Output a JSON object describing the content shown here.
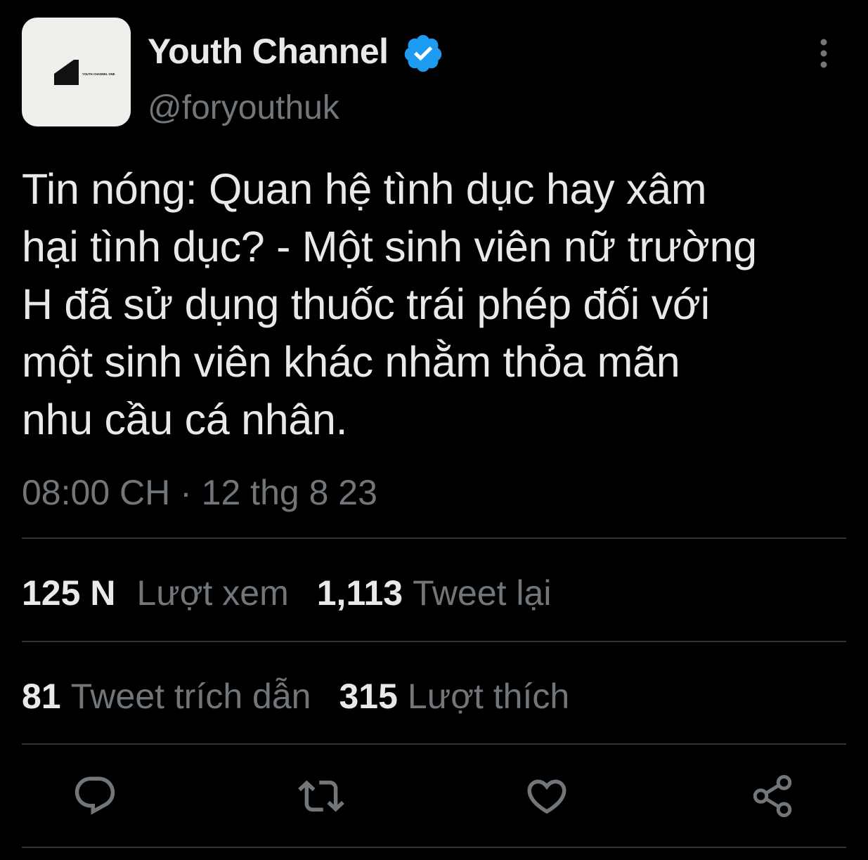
{
  "tweet": {
    "author": {
      "display_name": "Youth Channel",
      "handle": "@foryouthuk",
      "verified": true,
      "avatar_text": "YOUTH CHANNEL ONE"
    },
    "text": "Tin nóng: Quan hệ tình dục hay xâm\nhại tình dục? - Một sinh viên nữ trường\nH đã sử dụng thuốc trái phép đối với\nmột sinh viên khác nhằm thỏa mãn\nnhu cầu cá nhân.",
    "timestamp": "08:00 CH · 12 thg 8 23",
    "stats": {
      "views_count": "125 N",
      "views_label": "Lượt xem",
      "retweets_count": "1,113",
      "retweets_label": "Tweet lại",
      "quotes_count": "81",
      "quotes_label": "Tweet trích dẫn",
      "likes_count": "315",
      "likes_label": "Lượt thích"
    }
  },
  "actions": [
    "reply-icon",
    "retweet-icon",
    "like-icon",
    "share-icon"
  ],
  "icons": {
    "more": "more-vertical-icon",
    "verified": "verified-badge-icon"
  },
  "colors": {
    "background": "#000000",
    "text_primary": "#e7e9ea",
    "text_secondary": "#71767b",
    "divider": "#2f3336",
    "verified_blue": "#1d9bf0"
  }
}
